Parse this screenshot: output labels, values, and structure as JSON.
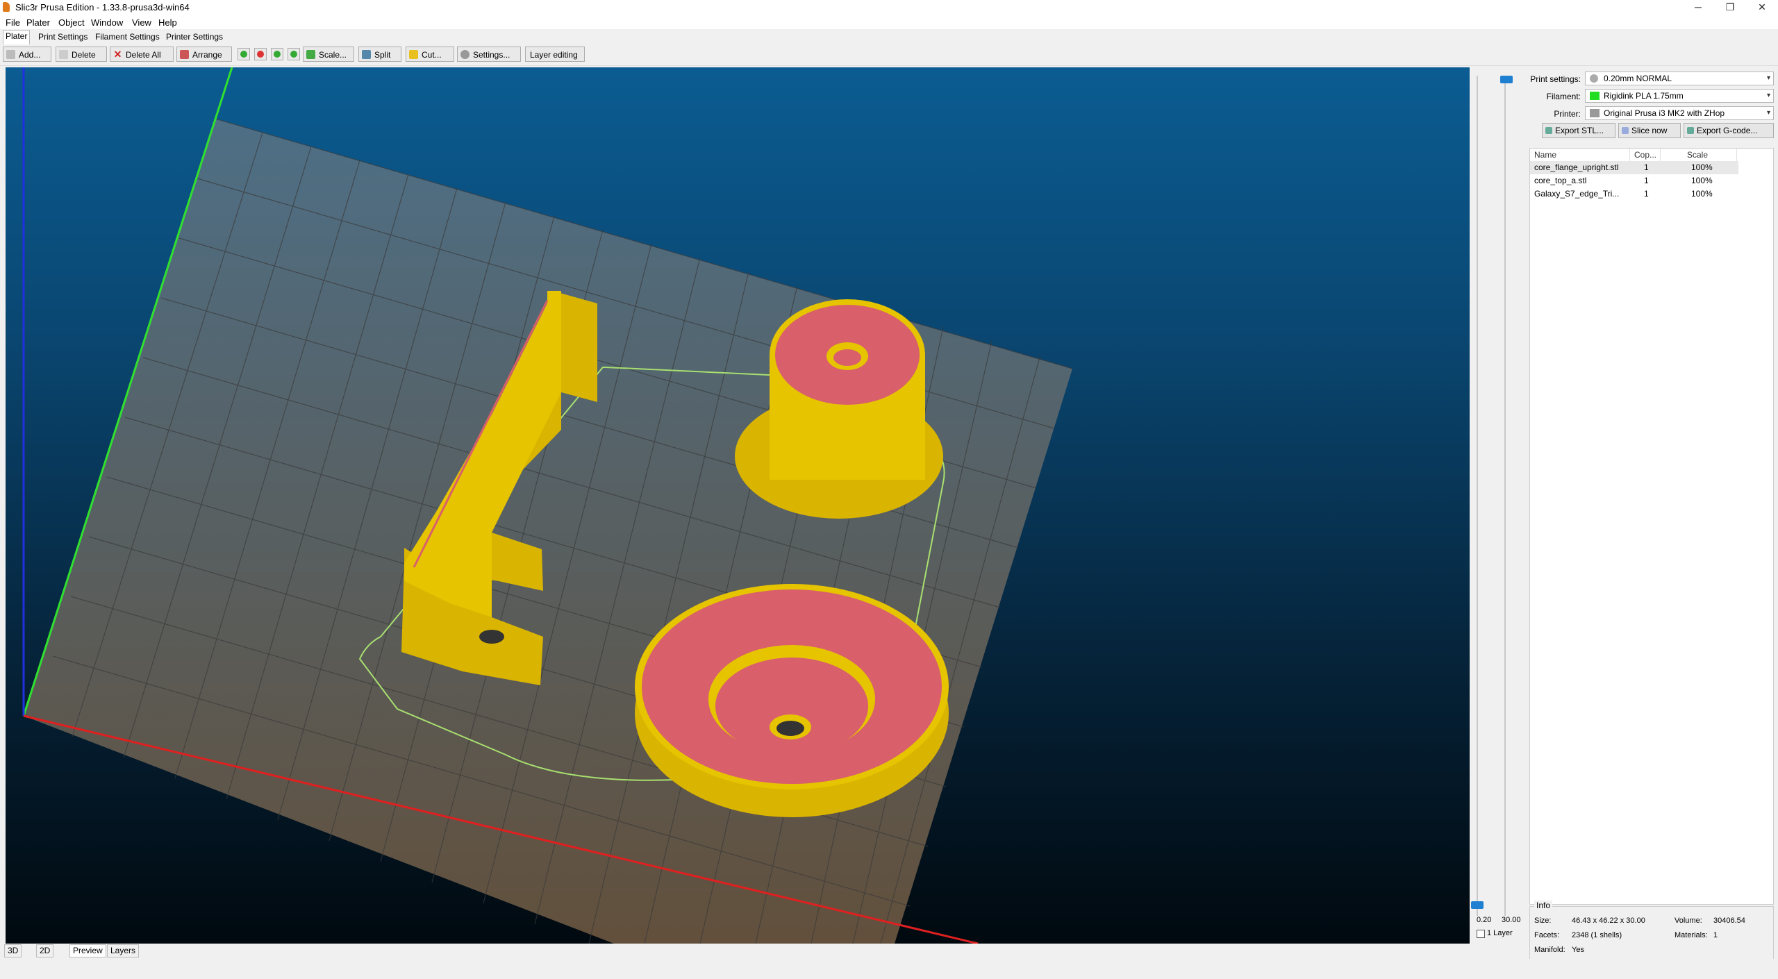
{
  "window": {
    "title": "Slic3r Prusa Edition - 1.33.8-prusa3d-win64",
    "controls": {
      "minimize": "─",
      "restore": "❐",
      "close": "✕"
    }
  },
  "menu": [
    "File",
    "Plater",
    "Object",
    "Window",
    "View",
    "Help"
  ],
  "tabs": [
    "Plater",
    "Print Settings",
    "Filament Settings",
    "Printer Settings"
  ],
  "toolbar": {
    "add": "Add...",
    "delete": "Delete",
    "delete_all": "Delete All",
    "arrange": "Arrange",
    "scale": "Scale...",
    "split": "Split",
    "cut": "Cut...",
    "settings": "Settings...",
    "layer_editing": "Layer editing"
  },
  "layers_slider": {
    "min_label": "0.20",
    "max_label": "30.00",
    "one_layer_label": "1 Layer"
  },
  "view_tabs": [
    "3D",
    "2D",
    "Preview",
    "Layers"
  ],
  "sidebar": {
    "print_settings_label": "Print settings:",
    "print_settings_value": "0.20mm NORMAL",
    "filament_label": "Filament:",
    "filament_value": "Rigidink PLA 1.75mm",
    "filament_color": "#22dd22",
    "printer_label": "Printer:",
    "printer_value": "Original Prusa i3 MK2 with ZHop",
    "export_stl": "Export STL...",
    "slice_now": "Slice now",
    "export_gcode": "Export G-code...",
    "columns": [
      "Name",
      "Cop...",
      "Scale"
    ],
    "objects": [
      {
        "name": "core_flange_upright.stl",
        "copies": "1",
        "scale": "100%"
      },
      {
        "name": "core_top_a.stl",
        "copies": "1",
        "scale": "100%"
      },
      {
        "name": "Galaxy_S7_edge_Tri...",
        "copies": "1",
        "scale": "100%"
      }
    ]
  },
  "info": {
    "title": "Info",
    "size_label": "Size:",
    "size_value": "46.43 x 46.22 x 30.00",
    "volume_label": "Volume:",
    "volume_value": "30406.54",
    "facets_label": "Facets:",
    "facets_value": "2348 (1 shells)",
    "materials_label": "Materials:",
    "materials_value": "1",
    "manifold_label": "Manifold:",
    "manifold_value": "Yes"
  },
  "colors": {
    "part_yellow": "#e6c400",
    "top_red": "#d9606a",
    "skirt": "#a8e070",
    "axis_x": "#e02020",
    "axis_y": "#30e030",
    "axis_z": "#2030e0"
  }
}
